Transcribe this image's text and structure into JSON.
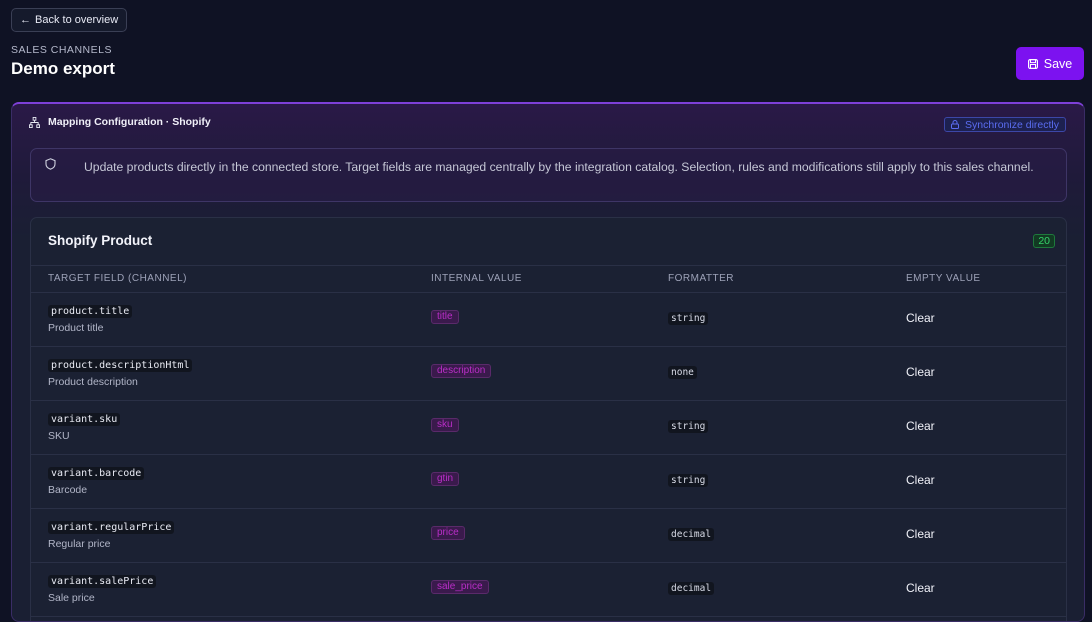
{
  "nav": {
    "back_label": "Back to overview"
  },
  "header": {
    "subtitle": "SALES CHANNELS",
    "title": "Demo export",
    "save_label": "Save"
  },
  "panel": {
    "title": "Mapping Configuration · Shopify",
    "sync_label": "Synchronize directly",
    "notice": "Update products directly in the connected store. Target fields are managed centrally by the integration catalog. Selection, rules and modifications still apply to this sales channel."
  },
  "card": {
    "title": "Shopify Product",
    "count": "20",
    "columns": [
      "TARGET FIELD (CHANNEL)",
      "INTERNAL VALUE",
      "FORMATTER",
      "EMPTY VALUE"
    ],
    "rows": [
      {
        "field": "product.title",
        "label": "Product title",
        "internal": "title",
        "formatter": "string",
        "empty": "Clear"
      },
      {
        "field": "product.descriptionHtml",
        "label": "Product description",
        "internal": "description",
        "formatter": "none",
        "empty": "Clear"
      },
      {
        "field": "variant.sku",
        "label": "SKU",
        "internal": "sku",
        "formatter": "string",
        "empty": "Clear"
      },
      {
        "field": "variant.barcode",
        "label": "Barcode",
        "internal": "gtin",
        "formatter": "string",
        "empty": "Clear"
      },
      {
        "field": "variant.regularPrice",
        "label": "Regular price",
        "internal": "price",
        "formatter": "decimal",
        "empty": "Clear"
      },
      {
        "field": "variant.salePrice",
        "label": "Sale price",
        "internal": "sale_price",
        "formatter": "decimal",
        "empty": "Clear"
      }
    ]
  },
  "colors": {
    "accent": "#7c12f0",
    "background": "#0f1224",
    "internal_tag": "#b92ec7",
    "sync_blue": "#5a6cf0",
    "count_green": "#36d36a"
  }
}
